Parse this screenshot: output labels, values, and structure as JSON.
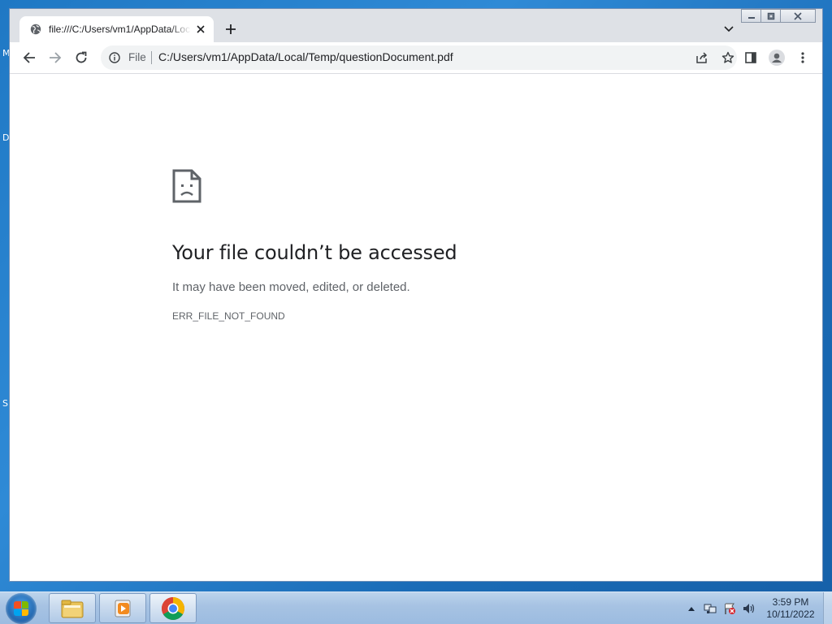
{
  "desktop": {
    "left_letters": [
      "M",
      "D",
      "S"
    ]
  },
  "browser": {
    "tab": {
      "title": "file:///C:/Users/vm1/AppData/Local/Temp/questionDocument.pdf",
      "favicon": "globe-icon"
    },
    "omnibox": {
      "chip": "File",
      "url": "C:/Users/vm1/AppData/Local/Temp/questionDocument.pdf"
    }
  },
  "error_page": {
    "title": "Your file couldn’t be accessed",
    "subtitle": "It may have been moved, edited, or deleted.",
    "code": "ERR_FILE_NOT_FOUND",
    "icon": "sad-file-icon"
  },
  "taskbar": {
    "items": [
      "file-explorer-icon",
      "media-player-icon",
      "chrome-icon"
    ],
    "clock": {
      "time": "3:59 PM",
      "date": "10/11/2022"
    }
  },
  "colors": {
    "accent": "#1a73e8",
    "text": "#202124",
    "muted": "#5f6368",
    "desktop": "#1f78c4"
  }
}
